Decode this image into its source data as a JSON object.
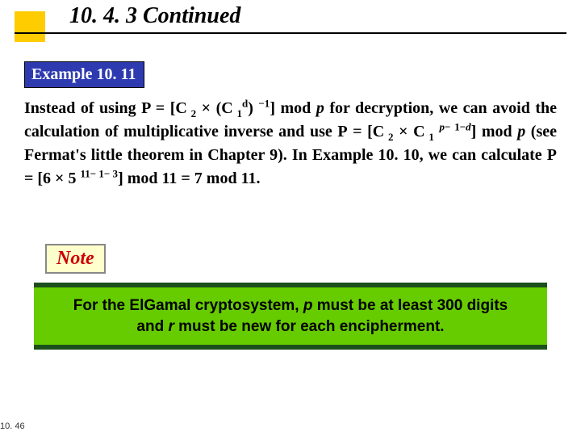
{
  "heading": "10. 4. 3  Continued",
  "example_label": "Example 10. 11",
  "body_html": "Instead of using P = [C<sub>&nbsp;2</sub> × (C<sub>&nbsp;1</sub><sup>d</sup>)&nbsp;<sup>−1</sup>] mod <i>p</i> for decryption, we can avoid the calculation of multiplicative inverse and use P&nbsp;=&nbsp;[C<sub>&nbsp;2</sub>&nbsp;×&nbsp;C<sub>&nbsp;1</sub>&nbsp;<sup><i>p</i>−&nbsp;1−<i>d</i></sup>] mod <i>p</i> (see Fermat's little theorem in Chapter 9). In Example 10. 10, we can calculate P = [6 × 5&nbsp;<sup>11−&nbsp;1−&nbsp;3</sup>] mod 11 = 7 mod 11.",
  "note_label": "Note",
  "note_line1_html": "For the ElGamal cryptosystem, <em>p</em> must be at least 300 digits",
  "note_line2_html": "and <em>r</em> must be new for each encipherment.",
  "page_number": "10. 46"
}
